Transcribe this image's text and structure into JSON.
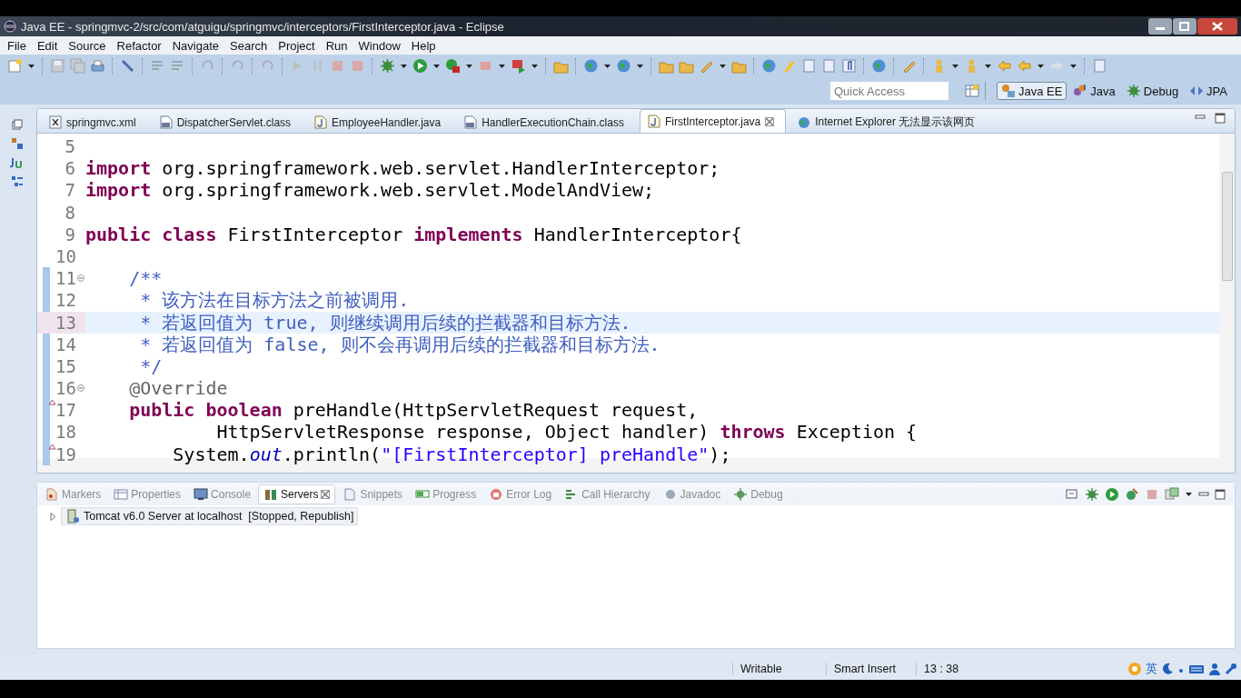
{
  "window": {
    "title": "Java EE - springmvc-2/src/com/atguigu/springmvc/interceptors/FirstInterceptor.java - Eclipse"
  },
  "menu": [
    "File",
    "Edit",
    "Source",
    "Refactor",
    "Navigate",
    "Search",
    "Project",
    "Run",
    "Window",
    "Help"
  ],
  "quick_access": {
    "placeholder": "Quick Access"
  },
  "perspectives": [
    {
      "label": "Java EE",
      "kind": "javaee",
      "selected": true
    },
    {
      "label": "Java",
      "kind": "java",
      "selected": false
    },
    {
      "label": "Debug",
      "kind": "debug",
      "selected": false
    },
    {
      "label": "JPA",
      "kind": "jpa",
      "selected": false
    }
  ],
  "editor_tabs": [
    {
      "label": "springmvc.xml",
      "kind": "xml",
      "selected": false
    },
    {
      "label": "DispatcherServlet.class",
      "kind": "class",
      "selected": false
    },
    {
      "label": "EmployeeHandler.java",
      "kind": "java",
      "selected": false
    },
    {
      "label": "HandlerExecutionChain.class",
      "kind": "class",
      "selected": false
    },
    {
      "label": "FirstInterceptor.java",
      "kind": "java",
      "selected": true
    },
    {
      "label": "Internet Explorer 无法显示该网页",
      "kind": "browser",
      "selected": false
    }
  ],
  "code_lines": [
    {
      "number": "5",
      "current": false
    },
    {
      "number": "6",
      "current": false,
      "tokens": [
        {
          "kind": "keyword",
          "text": "import"
        },
        {
          "kind": "plain",
          "text": " org.springframework.web.servlet.HandlerInterceptor;"
        }
      ]
    },
    {
      "number": "7",
      "current": false,
      "tokens": [
        {
          "kind": "keyword",
          "text": "import"
        },
        {
          "kind": "plain",
          "text": " org.springframework.web.servlet.ModelAndView;"
        }
      ]
    },
    {
      "number": "8",
      "current": false
    },
    {
      "number": "9",
      "current": false,
      "tokens": [
        {
          "kind": "keyword",
          "text": "public class"
        },
        {
          "kind": "plain",
          "text": " FirstInterceptor "
        },
        {
          "kind": "keyword",
          "text": "implements"
        },
        {
          "kind": "plain",
          "text": " HandlerInterceptor{"
        }
      ]
    },
    {
      "number": "10",
      "current": false
    },
    {
      "number": "11",
      "current": false,
      "kind": "fold",
      "tokens": [
        {
          "kind": "comment",
          "text": "    /**"
        }
      ]
    },
    {
      "number": "12",
      "current": false,
      "tokens": [
        {
          "kind": "comment",
          "text": "     * 该方法在目标方法之前被调用."
        }
      ]
    },
    {
      "number": "13",
      "current": true,
      "tokens": [
        {
          "kind": "comment",
          "text": "     * 若返回值为 true, 则继续调用后续的拦截器和目标方法."
        }
      ]
    },
    {
      "number": "14",
      "current": false,
      "tokens": [
        {
          "kind": "comment",
          "text": "     * 若返回值为 false, 则不会再调用后续的拦截器和目标方法."
        }
      ]
    },
    {
      "number": "15",
      "current": false,
      "tokens": [
        {
          "kind": "comment",
          "text": "     */"
        }
      ]
    },
    {
      "number": "16",
      "current": false,
      "kind": "fold",
      "tokens": [
        {
          "kind": "annotation",
          "text": "    @Override"
        }
      ]
    },
    {
      "number": "17",
      "current": false,
      "kind": "override",
      "tokens": [
        {
          "kind": "keyword",
          "text": "    public boolean"
        },
        {
          "kind": "plain",
          "text": " preHandle(HttpServletRequest request,"
        }
      ]
    },
    {
      "number": "18",
      "current": false,
      "tokens": [
        {
          "kind": "plain",
          "text": "            HttpServletResponse response, Object handler) "
        },
        {
          "kind": "keyword",
          "text": "throws"
        },
        {
          "kind": "plain",
          "text": " Exception {"
        }
      ]
    },
    {
      "number": "19",
      "current": false,
      "kind": "override",
      "tokens": [
        {
          "kind": "plain",
          "text": "        System."
        },
        {
          "kind": "static",
          "text": "out"
        },
        {
          "kind": "plain",
          "text": ".println("
        },
        {
          "kind": "string",
          "text": "\"[FirstInterceptor] preHandle\""
        },
        {
          "kind": "plain",
          "text": ");"
        }
      ]
    }
  ],
  "panel_tabs": [
    {
      "label": "Markers",
      "kind": "markers",
      "selected": false
    },
    {
      "label": "Properties",
      "kind": "properties",
      "selected": false
    },
    {
      "label": "Console",
      "kind": "console",
      "selected": false
    },
    {
      "label": "Servers",
      "kind": "servers",
      "selected": true
    },
    {
      "label": "Snippets",
      "kind": "snippets",
      "selected": false
    },
    {
      "label": "Progress",
      "kind": "progress",
      "selected": false
    },
    {
      "label": "Error Log",
      "kind": "errorlog",
      "selected": false
    },
    {
      "label": "Call Hierarchy",
      "kind": "hierarchy",
      "selected": false
    },
    {
      "label": "Javadoc",
      "kind": "javadoc",
      "selected": false
    },
    {
      "label": "Debug",
      "kind": "debug",
      "selected": false
    }
  ],
  "servers": [
    {
      "label": "Tomcat v6.0 Server at localhost  [Stopped, Republish]",
      "expanded": false,
      "selected": true
    }
  ],
  "status_bar": {
    "writable": "Writable",
    "insert_mode": "Smart Insert",
    "position": "13 : 38"
  },
  "tray": {
    "ime": "英"
  }
}
